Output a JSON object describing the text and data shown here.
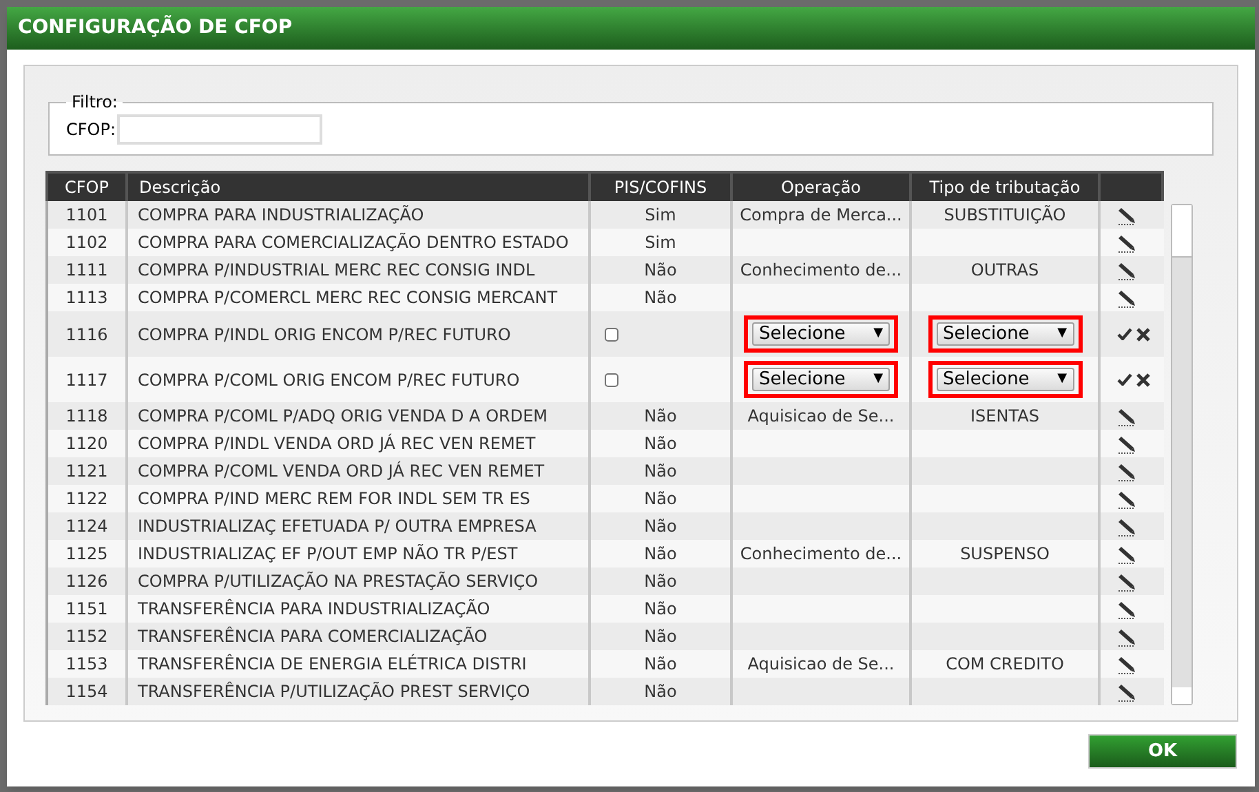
{
  "window": {
    "title": "CONFIGURAÇÃO DE CFOP"
  },
  "filter": {
    "legend": "Filtro:",
    "label": "CFOP:"
  },
  "table": {
    "columns": [
      "CFOP",
      "Descrição",
      "PIS/COFINS",
      "Operação",
      "Tipo de tributação"
    ],
    "rows": [
      {
        "kind": "view",
        "cfop": "1101",
        "descricao": "COMPRA PARA INDUSTRIALIZAÇÃO",
        "pis": "Sim",
        "operacao": "Compra de Merca...",
        "tipo": "SUBSTITUIÇÃO"
      },
      {
        "kind": "view",
        "cfop": "1102",
        "descricao": "COMPRA PARA COMERCIALIZAÇÃO DENTRO ESTADO",
        "pis": "Sim"
      },
      {
        "kind": "view",
        "cfop": "1111",
        "descricao": "COMPRA P/INDUSTRIAL MERC REC CONSIG INDL",
        "pis": "Não",
        "operacao": "Conhecimento de...",
        "tipo": "OUTRAS"
      },
      {
        "kind": "view",
        "cfop": "1113",
        "descricao": "COMPRA P/COMERCL MERC REC CONSIG MERCANT",
        "pis": "Não"
      },
      {
        "kind": "edit",
        "cfop": "1116",
        "descricao": "COMPRA P/INDL ORIG ENCOM P/REC FUTURO",
        "checked": false,
        "operacao_select": {
          "value": "Selecione",
          "arrow": "▼",
          "highlighted": true
        },
        "tipo_select": {
          "value": "Selecione",
          "arrow": "▼",
          "highlighted": true
        }
      },
      {
        "kind": "edit",
        "cfop": "1117",
        "descricao": "COMPRA P/COML ORIG ENCOM P/REC FUTURO",
        "checked": false,
        "operacao_select": {
          "value": "Selecione",
          "arrow": "▼",
          "highlighted": true
        },
        "tipo_select": {
          "value": "Selecione",
          "arrow": "▼",
          "highlighted": true
        }
      },
      {
        "kind": "view",
        "cfop": "1118",
        "descricao": "COMPRA P/COML P/ADQ ORIG VENDA D A ORDEM",
        "pis": "Não",
        "operacao": "Aquisicao de Se...",
        "tipo": "ISENTAS"
      },
      {
        "kind": "view",
        "cfop": "1120",
        "descricao": "COMPRA P/INDL VENDA ORD JÁ REC VEN REMET",
        "pis": "Não"
      },
      {
        "kind": "view",
        "cfop": "1121",
        "descricao": "COMPRA P/COML VENDA ORD JÁ REC VEN REMET",
        "pis": "Não"
      },
      {
        "kind": "view",
        "cfop": "1122",
        "descricao": "COMPRA P/IND MERC REM FOR INDL SEM TR ES",
        "pis": "Não"
      },
      {
        "kind": "view",
        "cfop": "1124",
        "descricao": "INDUSTRIALIZAÇ EFETUADA P/ OUTRA EMPRESA",
        "pis": "Não"
      },
      {
        "kind": "view",
        "cfop": "1125",
        "descricao": "INDUSTRIALIZAÇ EF P/OUT EMP NÃO TR P/EST",
        "pis": "Não",
        "operacao": "Conhecimento de...",
        "tipo": "SUSPENSO"
      },
      {
        "kind": "view",
        "cfop": "1126",
        "descricao": "COMPRA P/UTILIZAÇÃO NA PRESTAÇÃO SERVIÇO",
        "pis": "Não"
      },
      {
        "kind": "view",
        "cfop": "1151",
        "descricao": "TRANSFERÊNCIA PARA INDUSTRIALIZAÇÃO",
        "pis": "Não"
      },
      {
        "kind": "view",
        "cfop": "1152",
        "descricao": "TRANSFERÊNCIA PARA COMERCIALIZAÇÃO",
        "pis": "Não"
      },
      {
        "kind": "view",
        "cfop": "1153",
        "descricao": "TRANSFERÊNCIA DE ENERGIA ELÉTRICA DISTRI",
        "pis": "Não",
        "operacao": "Aquisicao de Se...",
        "tipo": "COM CREDITO"
      },
      {
        "kind": "view",
        "cfop": "1154",
        "descricao": "TRANSFERÊNCIA P/UTILIZAÇÃO PREST SERVIÇO",
        "pis": "Não"
      }
    ]
  },
  "buttons": [
    "OK"
  ]
}
